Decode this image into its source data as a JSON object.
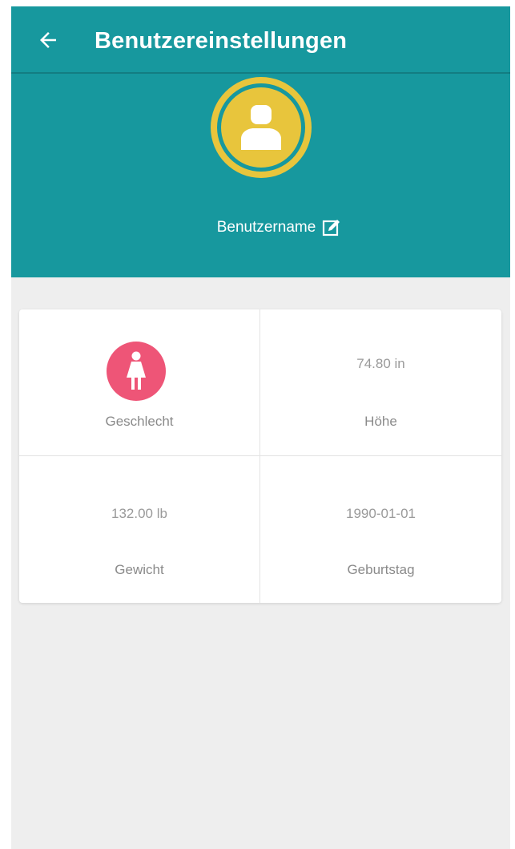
{
  "appbar": {
    "title": "Benutzereinstellungen"
  },
  "profile": {
    "username": "Benutzername"
  },
  "stats": {
    "gender": {
      "label": "Geschlecht",
      "icon": "female-icon"
    },
    "height": {
      "value": "74.80 in",
      "label": "Höhe"
    },
    "weight": {
      "value": "132.00 lb",
      "label": "Gewicht"
    },
    "birthday": {
      "value": "1990-01-01",
      "label": "Geburtstag"
    }
  },
  "colors": {
    "primary": "#17989e",
    "avatar": "#e8c53c",
    "gender_badge": "#ee5577",
    "background": "#eeeeee"
  }
}
